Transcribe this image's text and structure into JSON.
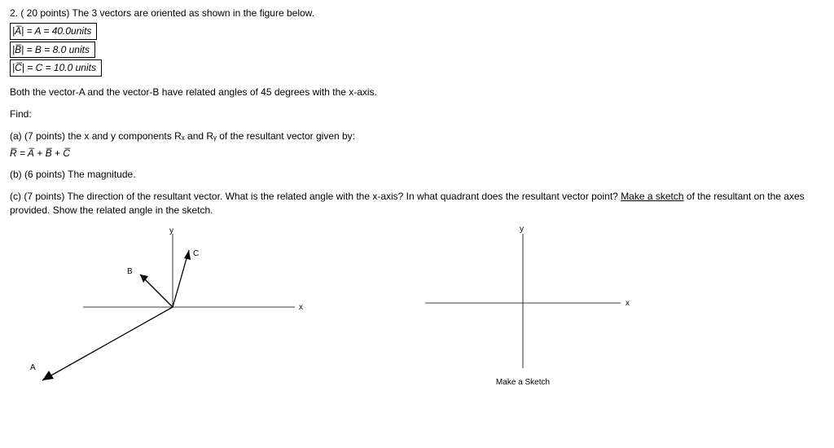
{
  "problem": {
    "header": "2. ( 20 points) The 3 vectors are oriented as shown in the figure below.",
    "magA": "|A̅| = A = 40.0units",
    "magB": "|B̅| = B = 8.0 units",
    "magC": "|C̅| = C = 10.0 units",
    "angleNote": "Both the vector-A and the vector-B have related angles of 45 degrees with the x-axis.",
    "findLabel": "Find:",
    "partA": "(a) (7 points) the x and y components Rₓ and Rᵧ of the resultant vector given by:",
    "resultantEq": "R̅ = A̅ + B̅ + C̅",
    "partB": "(b) (6 points) The magnitude.",
    "partC": "(c) (7 points) The direction of the resultant vector. What is the related angle with the x-axis? In what quadrant does the resultant vector point? ",
    "partCUnderline": "Make a sketch",
    "partCEnd": " of the resultant on the axes provided. Show the related angle in the sketch."
  },
  "fig1": {
    "labelY": "y",
    "labelX": "x",
    "labelA": "A",
    "labelB": "B",
    "labelC": "C"
  },
  "fig2": {
    "labelY": "y",
    "labelX": "x",
    "caption": "Make a Sketch"
  }
}
